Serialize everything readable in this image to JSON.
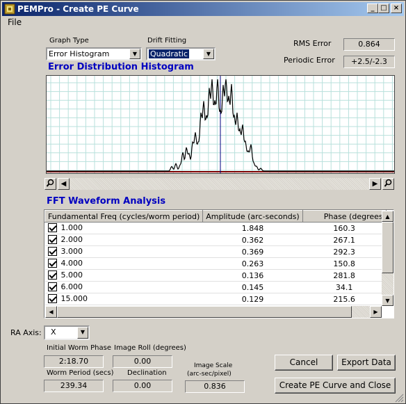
{
  "window": {
    "title": "PEMPro - Create PE Curve",
    "controls": {
      "minimize": "_",
      "maximize": "□",
      "close": "×"
    }
  },
  "menu": {
    "file": "File"
  },
  "graph_type": {
    "label": "Graph Type",
    "value": "Error Histogram"
  },
  "drift_fitting": {
    "label": "Drift Fitting",
    "value": "Quadratic"
  },
  "rms_error": {
    "label": "RMS Error",
    "value": "0.864"
  },
  "periodic_error": {
    "label": "Periodic Error",
    "value": "+2.5/-2.3"
  },
  "histogram": {
    "title": "Error Distribution Histogram",
    "colors": {
      "grid": "#b8e0dc",
      "axis": "#800000",
      "curve": "#000000",
      "center": "#000080"
    }
  },
  "fft": {
    "title": "FFT Waveform Analysis",
    "columns": [
      "Fundamental Freq (cycles/worm period)",
      "Amplitude (arc-seconds)",
      "Phase (degrees"
    ],
    "rows": [
      {
        "freq": "1.000",
        "amplitude": "1.848",
        "phase": "160.3"
      },
      {
        "freq": "2.000",
        "amplitude": "0.362",
        "phase": "267.1"
      },
      {
        "freq": "3.000",
        "amplitude": "0.369",
        "phase": "292.3"
      },
      {
        "freq": "4.000",
        "amplitude": "0.263",
        "phase": "150.8"
      },
      {
        "freq": "5.000",
        "amplitude": "0.136",
        "phase": "281.8"
      },
      {
        "freq": "6.000",
        "amplitude": "0.145",
        "phase": "34.1"
      },
      {
        "freq": "15.000",
        "amplitude": "0.129",
        "phase": "215.6"
      }
    ]
  },
  "ra_axis": {
    "label": "RA Axis:",
    "value": "X"
  },
  "initial_worm_phase": {
    "label": "Initial Worm Phase",
    "value": "2:18.70"
  },
  "worm_period": {
    "label": "Worm Period (secs)",
    "value": "239.34"
  },
  "image_roll": {
    "label": "Image Roll (degrees)",
    "value": "0.00"
  },
  "declination": {
    "label": "Declination",
    "value": "0.00"
  },
  "image_scale": {
    "label1": "Image Scale",
    "label2": "(arc-sec/pixel)",
    "value": "0.836"
  },
  "buttons": {
    "cancel": "Cancel",
    "export": "Export Data",
    "create": "Create PE Curve and Close"
  }
}
